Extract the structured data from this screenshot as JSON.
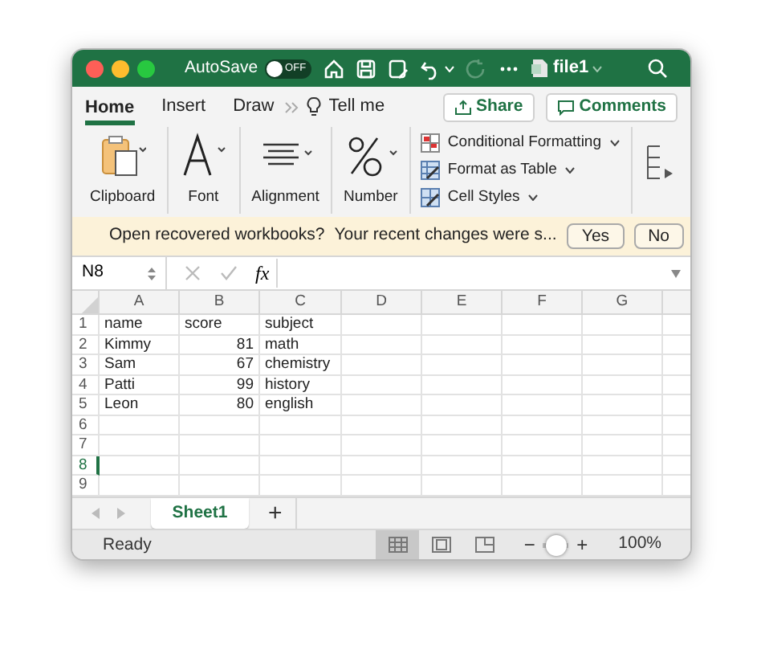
{
  "title_bar": {
    "autosave_label": "AutoSave",
    "autosave_toggle": {
      "label": "OFF",
      "on": false
    },
    "file_name": "file1"
  },
  "ribbon_tabs": [
    {
      "label": "Home",
      "selected": true
    },
    {
      "label": "Insert",
      "selected": false
    },
    {
      "label": "Draw",
      "selected": false
    }
  ],
  "tell_me": "Tell me",
  "share": "Share",
  "comments": "Comments",
  "ribbon_groups": [
    {
      "label": "Clipboard",
      "kind": "clipboard"
    },
    {
      "label": "Font",
      "kind": "font"
    },
    {
      "label": "Alignment",
      "kind": "alignment"
    },
    {
      "label": "Number",
      "kind": "number"
    }
  ],
  "style_commands": [
    {
      "label": "Conditional Formatting",
      "kind": "conditional"
    },
    {
      "label": "Format as Table",
      "kind": "table"
    },
    {
      "label": "Cell Styles",
      "kind": "styles"
    }
  ],
  "message_bar": {
    "title": "Open recovered workbooks?",
    "text": "Your recent changes were s...",
    "buttons": [
      "Yes",
      "No"
    ]
  },
  "formula_bar": {
    "name_box": "N8",
    "function_label": "fx"
  },
  "sheet": {
    "columns": [
      {
        "label": "A",
        "selected": false
      },
      {
        "label": "B",
        "selected": false
      },
      {
        "label": "C",
        "selected": false
      },
      {
        "label": "D",
        "selected": false
      },
      {
        "label": "E",
        "selected": false
      },
      {
        "label": "F",
        "selected": false
      },
      {
        "label": "G",
        "selected": false
      }
    ],
    "rows": [
      {
        "number": "1",
        "selected": false,
        "cells": [
          {
            "text": "name",
            "kind": "text"
          },
          {
            "text": "score",
            "kind": "text"
          },
          {
            "text": "subject",
            "kind": "text"
          }
        ]
      },
      {
        "number": "2",
        "selected": false,
        "cells": [
          {
            "text": "Kimmy",
            "kind": "text"
          },
          {
            "text": "81",
            "kind": "number"
          },
          {
            "text": "math",
            "kind": "text"
          }
        ]
      },
      {
        "number": "3",
        "selected": false,
        "cells": [
          {
            "text": "Sam",
            "kind": "text"
          },
          {
            "text": "67",
            "kind": "number"
          },
          {
            "text": "chemistry",
            "kind": "text"
          }
        ]
      },
      {
        "number": "4",
        "selected": false,
        "cells": [
          {
            "text": "Patti",
            "kind": "text"
          },
          {
            "text": "99",
            "kind": "number"
          },
          {
            "text": "history",
            "kind": "text"
          }
        ]
      },
      {
        "number": "5",
        "selected": false,
        "cells": [
          {
            "text": "Leon",
            "kind": "text"
          },
          {
            "text": "80",
            "kind": "number"
          },
          {
            "text": "english",
            "kind": "text"
          }
        ]
      },
      {
        "number": "6",
        "selected": false,
        "cells": []
      },
      {
        "number": "7",
        "selected": false,
        "cells": []
      },
      {
        "number": "8",
        "selected": true,
        "cells": []
      },
      {
        "number": "9",
        "selected": false,
        "cells": []
      }
    ]
  },
  "sheet_tabs": [
    {
      "label": "Sheet1",
      "selected": true
    }
  ],
  "add_sheet": "+",
  "status_bar": {
    "status": "Ready",
    "views": [
      {
        "kind": "normal",
        "selected": true
      },
      {
        "kind": "page_layout",
        "selected": false
      },
      {
        "kind": "page_break",
        "selected": false
      }
    ],
    "zoom_out": "−",
    "zoom_in": "+",
    "zoom": {
      "level": 0.5
    },
    "zoom_label": "100%"
  }
}
